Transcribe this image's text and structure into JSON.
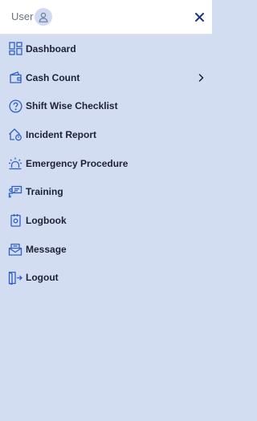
{
  "header": {
    "user_label": "User",
    "avatar_icon": "user-icon",
    "close_icon": "close-icon"
  },
  "colors": {
    "background": "#d3ddf2",
    "header_bg": "#ffffff",
    "icon_blue": "#2f5fc4",
    "close_navy": "#1f3a7a",
    "text": "#1c2233"
  },
  "menu": {
    "items": [
      {
        "label": "Dashboard",
        "icon": "dashboard-icon"
      },
      {
        "label": "Cash Count",
        "icon": "wallet-icon",
        "has_submenu": true
      },
      {
        "label": "Shift Wise Checklist",
        "icon": "question-circle-icon"
      },
      {
        "label": "Incident Report",
        "icon": "incident-icon"
      },
      {
        "label": "Emergency Procedure",
        "icon": "alarm-icon"
      },
      {
        "label": "Training",
        "icon": "training-icon"
      },
      {
        "label": "Logbook",
        "icon": "logbook-icon"
      },
      {
        "label": "Message",
        "icon": "message-icon"
      },
      {
        "label": "Logout",
        "icon": "logout-icon"
      }
    ]
  }
}
